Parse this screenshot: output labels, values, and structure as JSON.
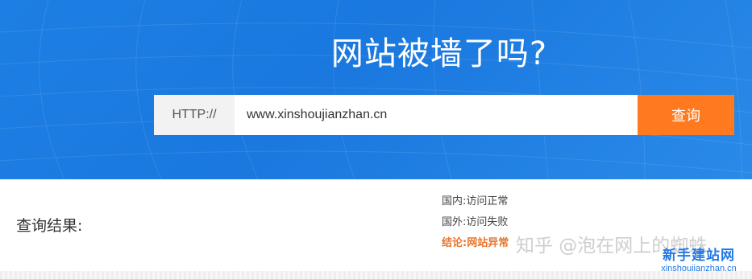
{
  "hero": {
    "title": "网站被墙了吗?"
  },
  "search": {
    "protocol_label": "HTTP://",
    "url_value": "www.xinshoujianzhan.cn",
    "button_label": "查询"
  },
  "result": {
    "label": "查询结果:",
    "lines": [
      "国内:访问正常",
      "国外:访问失败",
      "结论:网站异常"
    ]
  },
  "watermark": {
    "text": "知乎 @泡在网上的蜘蛛"
  },
  "site_logo": {
    "name": "新手建站网",
    "url": "xinshoujianzhan.cn"
  },
  "colors": {
    "hero_blue": "#1d7fe3",
    "button_orange": "#ff7a1f",
    "conclusion_orange": "#e8742a",
    "logo_blue": "#2279e6"
  }
}
